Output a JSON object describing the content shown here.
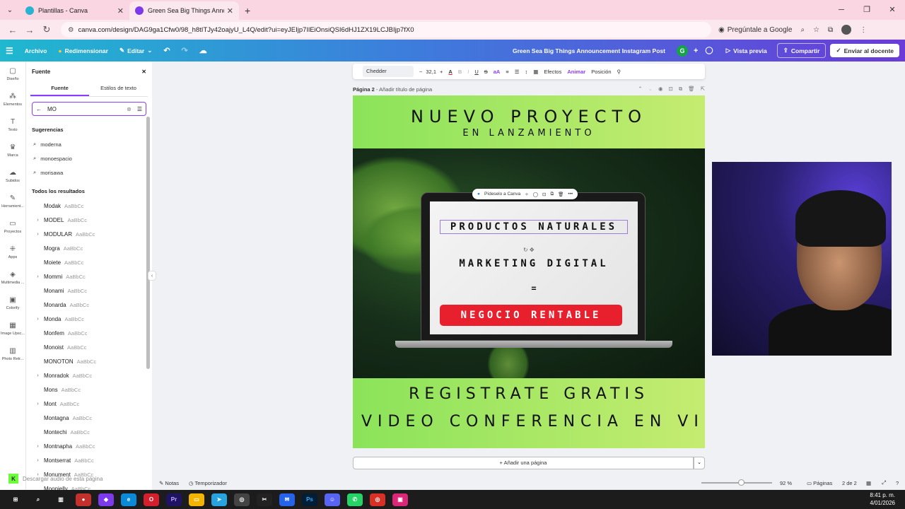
{
  "browser": {
    "tabs": [
      {
        "title": "Plantillas - Canva",
        "active": false
      },
      {
        "title": "Green Sea Big Things Announc",
        "active": true
      }
    ],
    "url": "canva.com/design/DAG9ga1Cfw0/98_h8tITJy42oajyU_L4Q/edit?ui=eyJEIjp7IlEiOnsiQSI6dHJ1ZX19LCJBIjp7fX0",
    "google_chip": "Pregúntale a Google"
  },
  "header": {
    "menu": [
      "Archivo",
      "Redimensionar",
      "Editar"
    ],
    "doc_title": "Green Sea Big Things Announcement Instagram Post",
    "avatar_letter": "G",
    "preview": "Vista previa",
    "share": "Compartir",
    "send": "Enviar al docente"
  },
  "rail": [
    "Diseño",
    "Elementos",
    "Texto",
    "Marca",
    "Subidos",
    "Herramient...",
    "Proyectos",
    "Apps",
    "Multimedia ...",
    "Colorify",
    "Image Upsc...",
    "Photo Retr..."
  ],
  "panel": {
    "title": "Fuente",
    "tabs": [
      "Fuente",
      "Estilos de texto"
    ],
    "search_value": "MO",
    "suggestions_title": "Sugerencias",
    "suggestions": [
      "moderna",
      "monoespacio",
      "morisawa"
    ],
    "results_title": "Todos los resultados",
    "fonts": [
      {
        "name": "Modak",
        "sample": "AaBbCc",
        "chev": false
      },
      {
        "name": "MODEL",
        "sample": "AaBbCc",
        "chev": true
      },
      {
        "name": "MODULAR",
        "sample": "AaBbCc",
        "chev": true
      },
      {
        "name": "Mogra",
        "sample": "AaBbCc",
        "chev": false
      },
      {
        "name": "Moiete",
        "sample": "AaBbCc",
        "chev": false
      },
      {
        "name": "Mommi",
        "sample": "AaBbCc",
        "chev": true
      },
      {
        "name": "Monami",
        "sample": "AaBbCc",
        "chev": false
      },
      {
        "name": "Monarda",
        "sample": "AaBbCc",
        "chev": false
      },
      {
        "name": "Monda",
        "sample": "AaBbCc",
        "chev": true
      },
      {
        "name": "Monfem",
        "sample": "AaBbCc",
        "chev": false
      },
      {
        "name": "Monoist",
        "sample": "AaBbCc",
        "chev": false
      },
      {
        "name": "MONOTON",
        "sample": "AaBbCc",
        "chev": false
      },
      {
        "name": "Monradok",
        "sample": "AaBbCc",
        "chev": true
      },
      {
        "name": "Mons",
        "sample": "AaBbCc",
        "chev": false
      },
      {
        "name": "Mont",
        "sample": "AaBbCc",
        "chev": true
      },
      {
        "name": "Montagna",
        "sample": "AaBbCc",
        "chev": false
      },
      {
        "name": "Montechi",
        "sample": "AaBbCc",
        "chev": false
      },
      {
        "name": "Montnapha",
        "sample": "AaBbCc",
        "chev": true
      },
      {
        "name": "Montserrat",
        "sample": "AaBbCc",
        "chev": true
      },
      {
        "name": "Monument",
        "sample": "AaBbCc",
        "chev": true
      },
      {
        "name": "Moonjelly",
        "sample": "AaBbCc",
        "chev": false
      }
    ]
  },
  "toolbar": {
    "font": "Chedder",
    "size": "32,1",
    "effects": "Efectos",
    "animate": "Animar",
    "position": "Posición"
  },
  "page": {
    "label": "Página 2",
    "title_placeholder": "Añadir título de página"
  },
  "design": {
    "title": "NUEVO PROYECTO",
    "subtitle": "EN LANZAMIENTO",
    "ask_canva": "Pídeselo a Canva",
    "line1": "PRODUCTOS NATURALES",
    "line2": "MARKETING DIGITAL",
    "line3": "=",
    "line4": "NEGOCIO RENTABLE",
    "bottom1": "REGISTRATE GRATIS",
    "bottom2": "VIDEO CONFERENCIA EN VI"
  },
  "add_page": "+ Añadir una página",
  "status": {
    "notes": "Notas",
    "timer": "Temporizador",
    "zoom": "92 %",
    "pages_label": "Páginas",
    "pages": "2 de 2"
  },
  "overlay": {
    "text": "Descargar audio de esta página"
  },
  "clock": {
    "time": "8:41 p. m.",
    "date": "4/01/2026"
  },
  "colors": {
    "accent": "#8b3dff",
    "red": "#e8202e",
    "green": "#8be35a"
  }
}
